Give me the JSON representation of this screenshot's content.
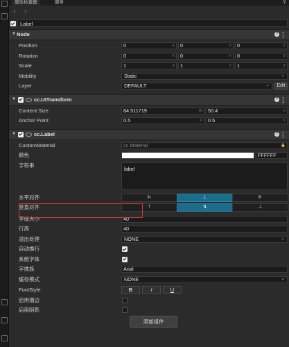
{
  "tabs": [
    "属性检查器",
    "服务"
  ],
  "node_name": "Label",
  "node_section": {
    "title": "Node",
    "position": {
      "label": "Position",
      "x": "0",
      "y": "0",
      "z": "0"
    },
    "rotation": {
      "label": "Rotation",
      "x": "0",
      "y": "0",
      "z": "0"
    },
    "scale": {
      "label": "Scale",
      "x": "1",
      "y": "1",
      "z": "1"
    },
    "mobility": {
      "label": "Mobility",
      "value": "Static"
    },
    "layer": {
      "label": "Layer",
      "value": "DEFAULT",
      "edit": "Edit"
    },
    "axes": {
      "x": "X",
      "y": "Y",
      "z": "Z",
      "w": "W",
      "h": "H"
    }
  },
  "uitransform": {
    "title": "cc.UITransform",
    "content_size": {
      "label": "Content Size",
      "w": "84.511719",
      "h": "50.4"
    },
    "anchor_point": {
      "label": "Anchor Point",
      "x": "0.5",
      "y": "0.5"
    }
  },
  "label_comp": {
    "title": "cc.Label",
    "custom_material": {
      "label": "CustomMaterial",
      "value": "cc.Material"
    },
    "color": {
      "label": "颜色",
      "hex": "FFFFFF",
      "swatch": "#ffffff"
    },
    "string": {
      "label": "字符串",
      "value": "label"
    },
    "h_align": {
      "label": "水平对齐"
    },
    "v_align": {
      "label": "竖直对齐"
    },
    "font_size": {
      "label": "字体大小",
      "value": "40"
    },
    "line_height": {
      "label": "行高",
      "value": "40"
    },
    "overflow": {
      "label": "溢出处理",
      "value": "NONE"
    },
    "wrap": {
      "label": "自动换行",
      "checked": true
    },
    "system_font": {
      "label": "系统字体",
      "checked": true
    },
    "font_family": {
      "label": "字体族",
      "value": "Arial"
    },
    "cache_mode": {
      "label": "缓存模式",
      "value": "NONE"
    },
    "font_style": {
      "label": "FontStyle",
      "bold": "B",
      "italic": "I",
      "underline": "U"
    },
    "outline": {
      "label": "启用描边",
      "checked": false
    },
    "shadow": {
      "label": "启用阴影",
      "checked": false
    }
  },
  "add_component": "添加组件",
  "colors": {
    "accent": "#1b6d8c",
    "highlight_box": "#d23a3a"
  }
}
